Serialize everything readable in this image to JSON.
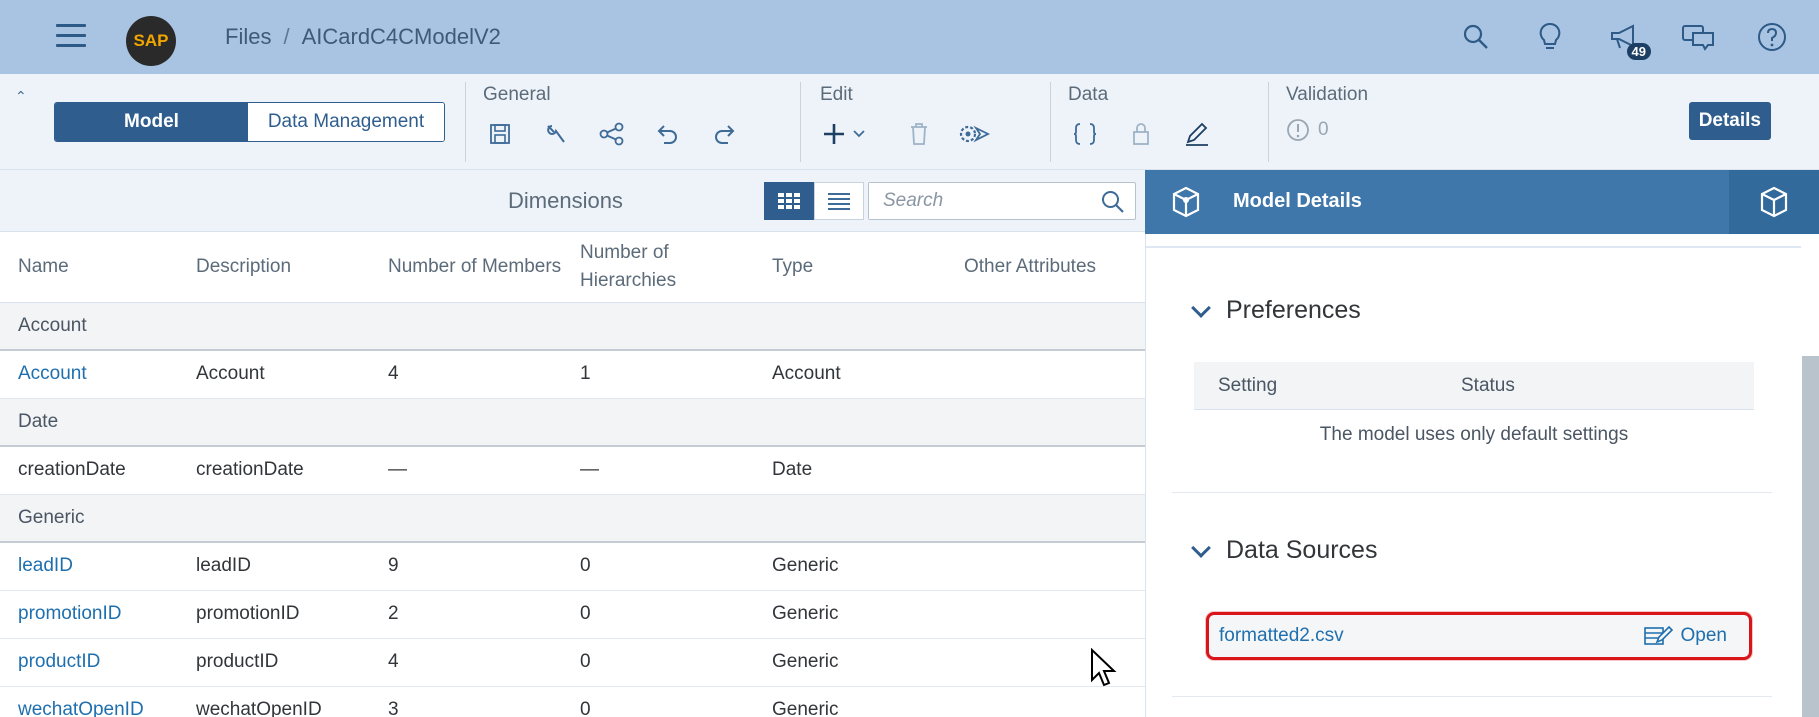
{
  "shell": {
    "logo_text": "SAP",
    "breadcrumb": [
      "Files",
      "AICardC4CModelV2"
    ],
    "breadcrumb_sep": "/",
    "notifications_count": "49",
    "icons": [
      "search-icon",
      "lightbulb-icon",
      "megaphone-icon",
      "chat-icon",
      "help-icon"
    ]
  },
  "toolbar": {
    "tabs": [
      "Model",
      "Data Management"
    ],
    "groups": {
      "general": "General",
      "edit": "Edit",
      "data": "Data",
      "validation": "Validation"
    },
    "validation_count": "0",
    "details_label": "Details"
  },
  "dimensions": {
    "title": "Dimensions",
    "search_placeholder": "Search",
    "columns": [
      "Name",
      "Description",
      "Number of Members",
      "Number of Hierarchies",
      "Type",
      "Other Attributes"
    ],
    "groups": [
      {
        "label": "Account",
        "rows": [
          {
            "name": "Account",
            "description": "Account",
            "members": "4",
            "hierarchies": "1",
            "type": "Account",
            "link": true
          }
        ]
      },
      {
        "label": "Date",
        "rows": [
          {
            "name": "creationDate",
            "description": "creationDate",
            "members": "—",
            "hierarchies": "—",
            "type": "Date",
            "link": false
          }
        ]
      },
      {
        "label": "Generic",
        "rows": [
          {
            "name": "leadID",
            "description": "leadID",
            "members": "9",
            "hierarchies": "0",
            "type": "Generic",
            "link": true
          },
          {
            "name": "promotionID",
            "description": "promotionID",
            "members": "2",
            "hierarchies": "0",
            "type": "Generic",
            "link": true
          },
          {
            "name": "productID",
            "description": "productID",
            "members": "4",
            "hierarchies": "0",
            "type": "Generic",
            "link": true
          },
          {
            "name": "wechatOpenID",
            "description": "wechatOpenID",
            "members": "3",
            "hierarchies": "0",
            "type": "Generic",
            "link": true
          }
        ]
      }
    ]
  },
  "model_details": {
    "title": "Model Details",
    "preferences": {
      "heading": "Preferences",
      "columns": [
        "Setting",
        "Status"
      ],
      "message": "The model uses only default settings"
    },
    "data_sources": {
      "heading": "Data Sources",
      "file": "formatted2.csv",
      "open_label": "Open"
    }
  },
  "colors": {
    "shell_bg": "#a9c4e2",
    "accent": "#2f5e8e",
    "panel_header": "#3f77aa",
    "link": "#1f6fae",
    "highlight": "#d8161a"
  }
}
